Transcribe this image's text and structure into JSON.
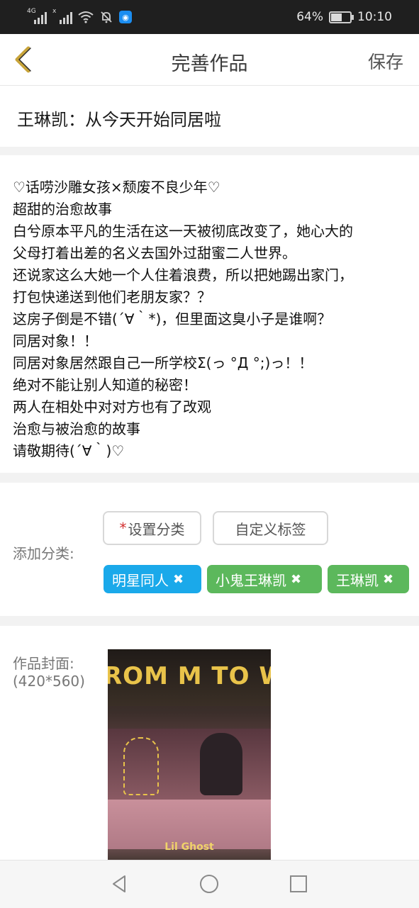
{
  "status_bar": {
    "network_left": "4G",
    "network_right": "x",
    "battery_percent": "64%",
    "battery_level": 0.64,
    "time": "10:10"
  },
  "header": {
    "title": "完善作品",
    "save_label": "保存",
    "accent_color": "#c8a43a"
  },
  "work": {
    "title": "王琳凯：从今天开始同居啦",
    "description": [
      "♡话唠沙雕女孩×颓废不良少年♡",
      "超甜的治愈故事",
      "白兮原本平凡的生活在这一天被彻底改变了，她心大的",
      "父母打着出差的名义去国外过甜蜜二人世界。",
      "还说家这么大她一个人住着浪费，所以把她踢出家门，",
      "打包快递送到他们老朋友家？？",
      "这房子倒是不错(´∀｀*)，但里面这臭小子是谁啊？",
      "同居对象！！",
      "同居对象居然跟自己一所学校Σ(っ °Д °;)っ！！",
      "绝对不能让别人知道的秘密！",
      "两人在相处中对对方也有了改观",
      "治愈与被治愈的故事",
      "请敬期待(´∀｀)♡"
    ]
  },
  "category": {
    "label": "添加分类:",
    "required_mark": "*",
    "set_category_label": "设置分类",
    "custom_tag_label": "自定义标签",
    "tags": [
      {
        "label": "明星同人",
        "color": "#1aa9ea"
      },
      {
        "label": "小鬼王琳凯",
        "color": "#5cb85c"
      },
      {
        "label": "王琳凯",
        "color": "#5cb85c"
      }
    ],
    "remove_glyph": "✖"
  },
  "cover": {
    "label": "作品封面:",
    "size_hint": "(420*560)",
    "image_title": "ROM M TO W",
    "image_brand": "Lil Ghost"
  }
}
